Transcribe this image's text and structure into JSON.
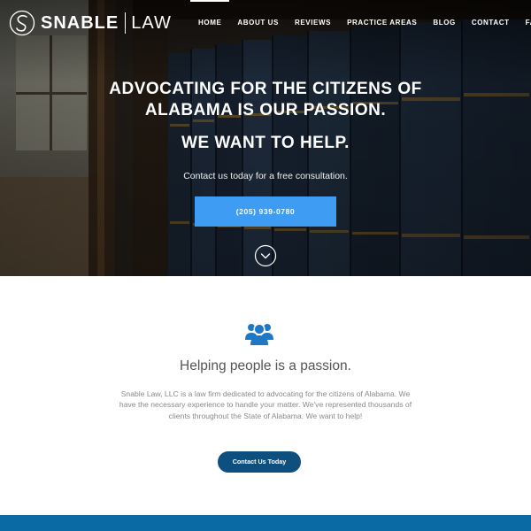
{
  "brand": {
    "name": "SNABLE",
    "suffix": "LAW"
  },
  "nav": {
    "items": [
      {
        "label": "HOME",
        "active": true
      },
      {
        "label": "ABOUT US",
        "active": false
      },
      {
        "label": "REVIEWS",
        "active": false
      },
      {
        "label": "PRACTICE AREAS",
        "active": false
      },
      {
        "label": "BLOG",
        "active": false
      },
      {
        "label": "CONTACT",
        "active": false
      },
      {
        "label": "FAQ'S",
        "active": false
      }
    ]
  },
  "hero": {
    "headline": "ADVOCATING FOR THE CITIZENS OF ALABAMA IS OUR PASSION.",
    "subhead": "WE WANT TO HELP.",
    "tagline": "Contact us today for a free consultation.",
    "phone_label": "(205) 939-0780",
    "scroll_icon": "chevron-down-circle-icon"
  },
  "about": {
    "icon": "people-group-icon",
    "title": "Helping people is a passion.",
    "body": "Snable Law, LLC is a law firm dedicated to advocating for the citizens of Alabama. We have the necessary experience to handle your matter. We've represented thousands of clients throughout the State of Alabama. We want to help!",
    "button_label": "Contact Us Today"
  },
  "colors": {
    "accent_blue": "#3f9cf3",
    "navy_button": "#0d4f7e",
    "footer_blue": "#0a6aa3",
    "icon_blue": "#1f78c4"
  }
}
